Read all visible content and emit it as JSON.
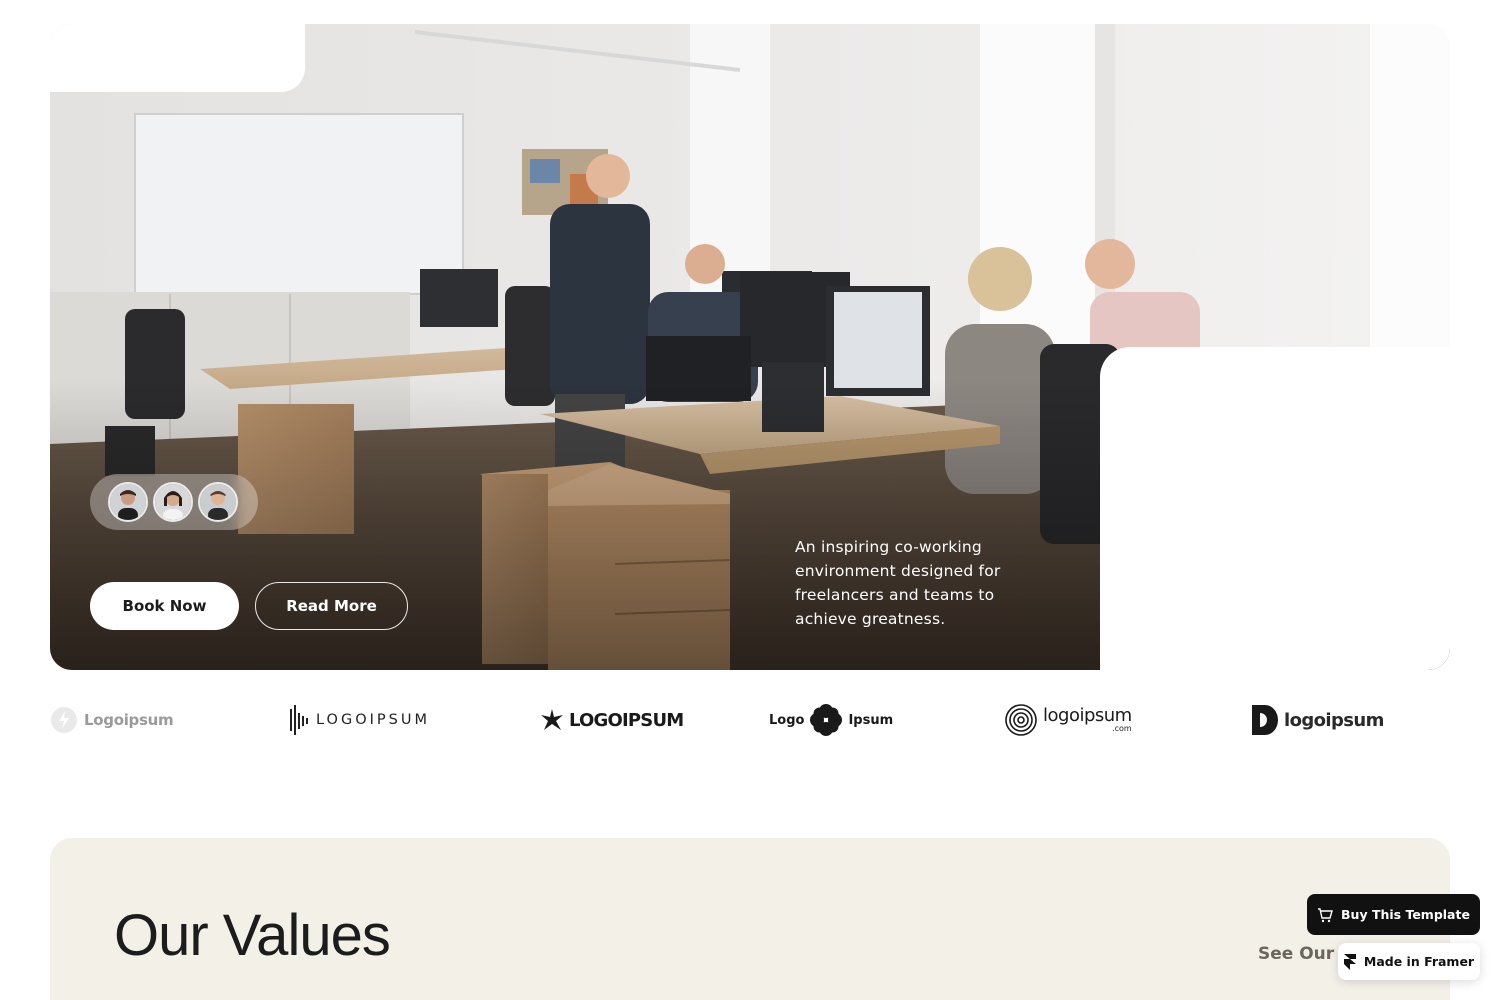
{
  "hero": {
    "tagline": "An inspiring co-working environment designed for freelancers and teams to achieve greatness.",
    "book_label": "Book Now",
    "read_label": "Read More",
    "avatars": [
      "avatar-man",
      "avatar-woman",
      "avatar-young-man"
    ]
  },
  "logos": [
    {
      "name": "logo-1",
      "icon": "bolt-circle-icon",
      "text": "Logoipsum"
    },
    {
      "name": "logo-2",
      "icon": "waveform-icon",
      "text": "LOGOIPSUM"
    },
    {
      "name": "logo-3",
      "icon": "star-burst-icon",
      "text": "LOGOIPSUM"
    },
    {
      "name": "logo-4",
      "icon": "flower-icon",
      "text_left": "Logo",
      "text_right": "Ipsum"
    },
    {
      "name": "logo-5",
      "icon": "spiral-icon",
      "text": "logoipsum",
      "suffix": ".com"
    },
    {
      "name": "logo-6",
      "icon": "half-circle-icon",
      "text": "logoipsum"
    }
  ],
  "values": {
    "title": "Our Values",
    "link": "See Our S"
  },
  "badges": {
    "buy": "Buy This Template",
    "framer": "Made in Framer"
  },
  "colors": {
    "values_bg": "#f3f0e8",
    "button_dark": "#111111",
    "text_dark": "#1c1c1c"
  }
}
